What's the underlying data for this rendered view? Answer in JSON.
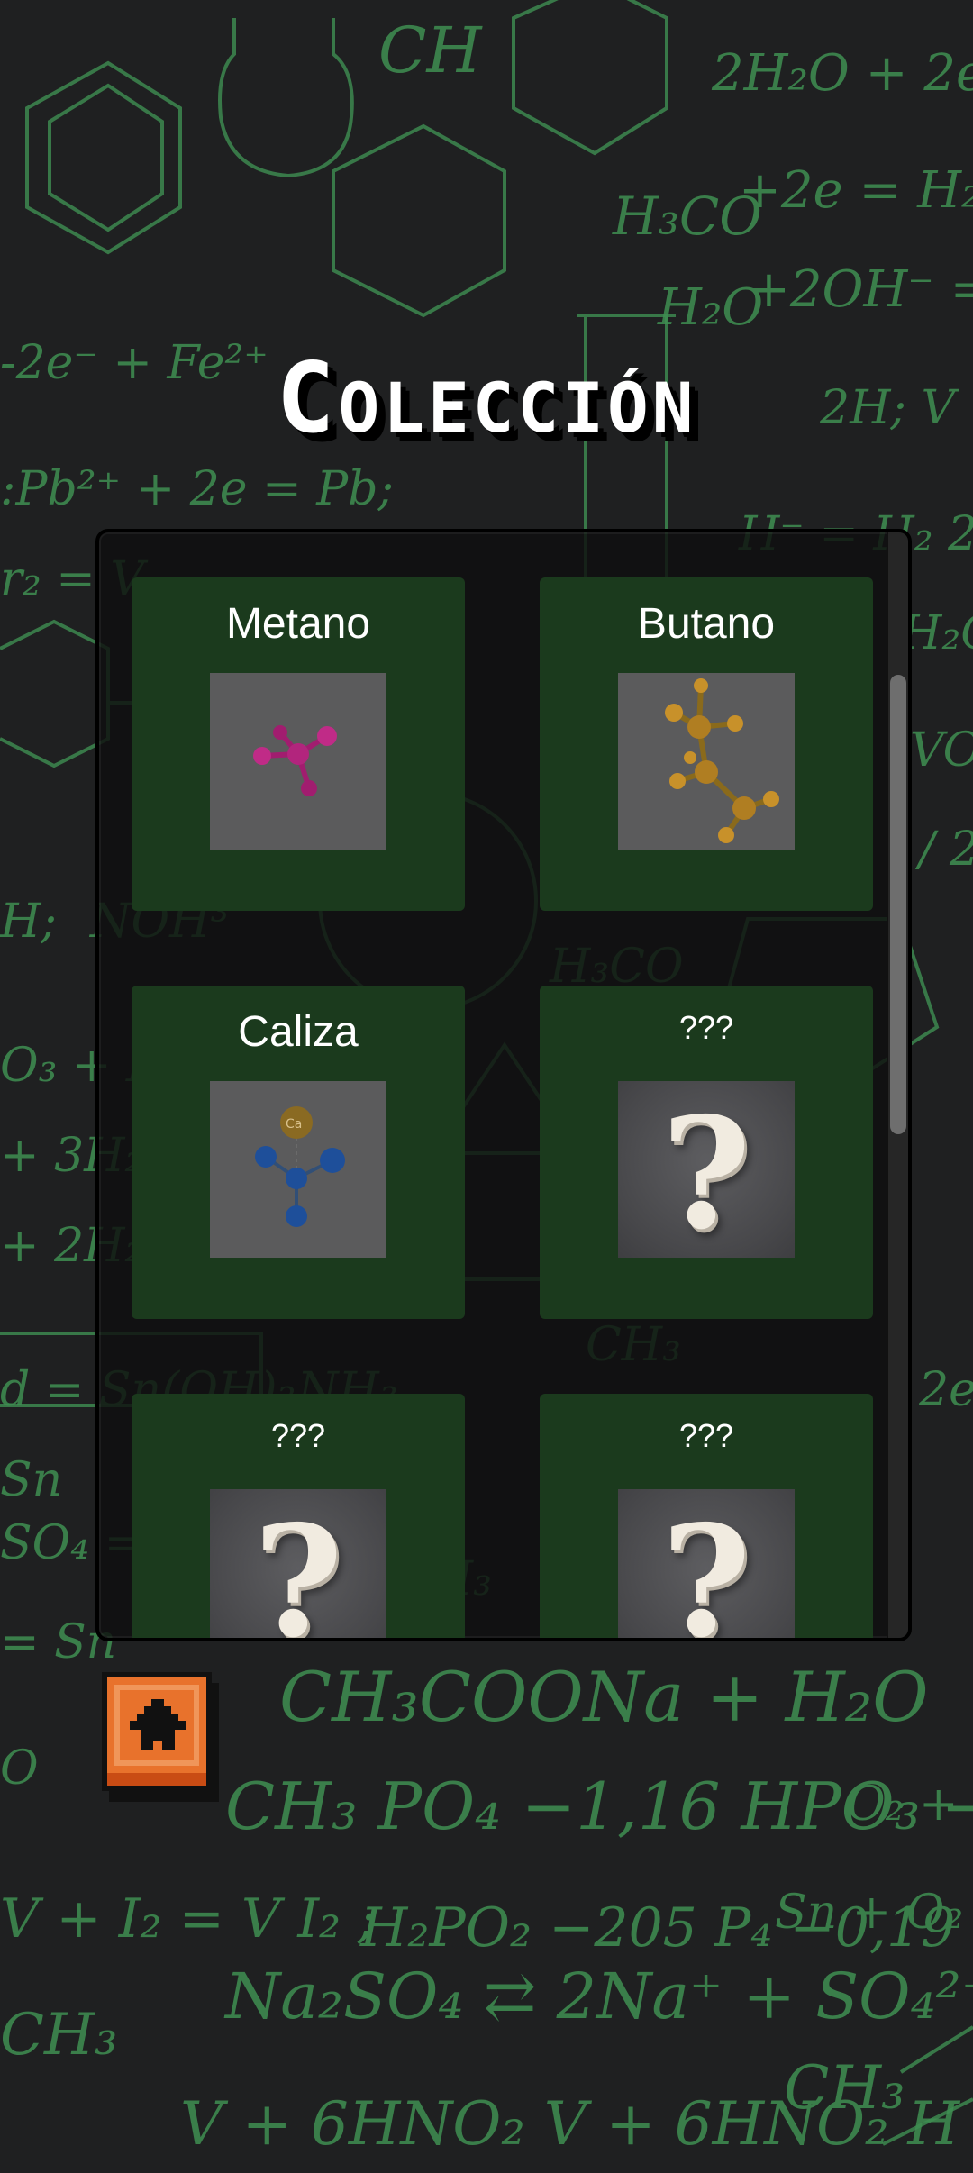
{
  "screen": {
    "title": "Colección"
  },
  "collection": {
    "items": [
      {
        "name": "Metano",
        "image": "metano-molecule",
        "discovered": true
      },
      {
        "name": "Butano",
        "image": "butano-molecule",
        "discovered": true
      },
      {
        "name": "Caliza",
        "image": "caliza-molecule",
        "discovered": true
      },
      {
        "name": "???",
        "image": "question-mark",
        "discovered": false
      },
      {
        "name": "???",
        "image": "question-mark",
        "discovered": false
      },
      {
        "name": "???",
        "image": "question-mark",
        "discovered": false
      }
    ]
  },
  "home_button": {
    "icon": "home-icon",
    "color": "#e8722c"
  },
  "colors": {
    "background": "#1f2021",
    "chalk": "#3f8f52",
    "card": "#1b3a1d",
    "panel": "#111111"
  }
}
